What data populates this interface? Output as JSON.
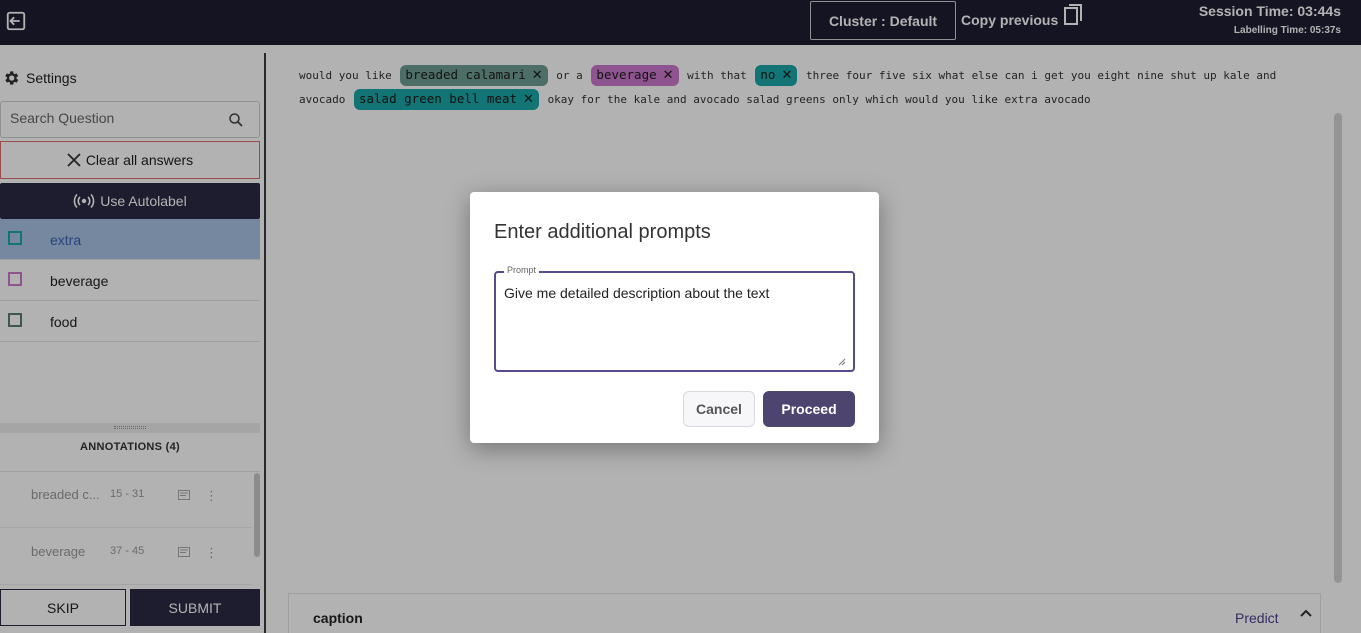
{
  "topbar": {
    "cluster_label": "Cluster : Default",
    "copy_previous_label": "Copy previous",
    "session_time": "Session Time: 03:44s",
    "labelling_time": "Labelling Time: 05:37s",
    "icons": [
      "exit-icon",
      "copy-icon"
    ]
  },
  "sidebar": {
    "settings_label": "Settings",
    "search_placeholder": "Search Question",
    "clear_all_label": "Clear all answers",
    "autolabel_label": "Use Autolabel",
    "labels": [
      {
        "text": "extra",
        "color": "#1aa6a6",
        "selected": true
      },
      {
        "text": "beverage",
        "color": "#cc79cd",
        "selected": false
      },
      {
        "text": "food",
        "color": "#5d7f76",
        "selected": false
      }
    ],
    "annotations_header": "ANNOTATIONS (4)",
    "annotations": [
      {
        "name": "breaded c...",
        "range": "15 - 31"
      },
      {
        "name": "beverage",
        "range": "37 - 45"
      }
    ],
    "skip_label": "SKIP",
    "submit_label": "SUBMIT"
  },
  "document": {
    "t1": "would you like",
    "chip1": "breaded calamari",
    "t2": "or a",
    "chip2": "beverage",
    "t3": "with that",
    "chip3": "no",
    "t4": "three four five six what else can i get you eight nine shut up kale and avocado",
    "chip4": "salad green bell meat",
    "t5": "okay for the kale and avocado salad greens only which would you like extra avocado"
  },
  "caption_panel": {
    "title": "caption",
    "predict_label": "Predict"
  },
  "modal": {
    "title": "Enter additional prompts",
    "field_legend": "Prompt",
    "field_value": "Give me detailed description about the text",
    "cancel_label": "Cancel",
    "proceed_label": "Proceed"
  },
  "colors": {
    "topbar_bg": "#1f1e33",
    "primary": "#2c2a44",
    "proceed": "#4e4470",
    "chip_food": "#6f9e92",
    "chip_beverage": "#cc79cd",
    "chip_extra": "#1aa6a6"
  }
}
